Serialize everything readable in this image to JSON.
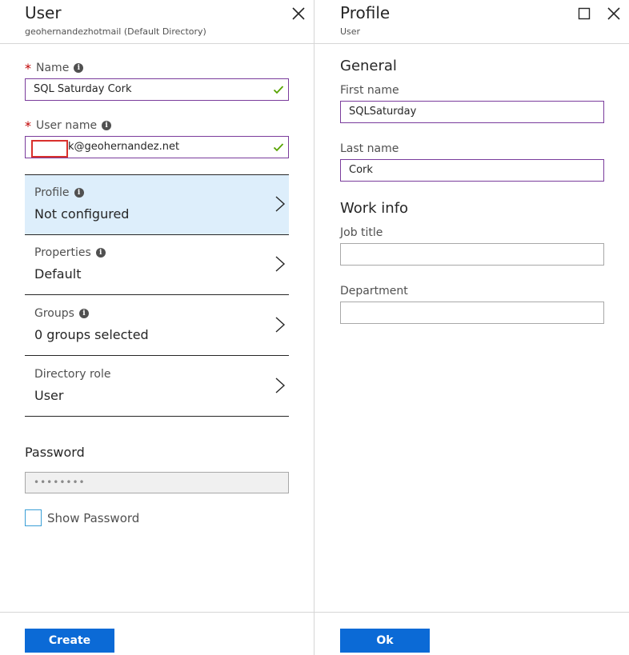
{
  "user_blade": {
    "title": "User",
    "subtitle": "geohernandezhotmail (Default Directory)",
    "name_label": "Name",
    "name_value": "SQL Saturday Cork",
    "username_label": "User name",
    "username_value": "k@geohernandez.net",
    "nav_items": [
      {
        "label": "Profile",
        "value": "Not configured",
        "has_info": true
      },
      {
        "label": "Properties",
        "value": "Default",
        "has_info": true
      },
      {
        "label": "Groups",
        "value": "0 groups selected",
        "has_info": true
      },
      {
        "label": "Directory role",
        "value": "User",
        "has_info": false
      }
    ],
    "password_heading": "Password",
    "password_value": "••••••••",
    "show_password_label": "Show Password",
    "create_label": "Create"
  },
  "profile_blade": {
    "title": "Profile",
    "subtitle": "User",
    "general_heading": "General",
    "first_name_label": "First name",
    "first_name_value": "SQLSaturday",
    "last_name_label": "Last name",
    "last_name_value": "Cork",
    "work_info_heading": "Work info",
    "job_title_label": "Job title",
    "job_title_value": "",
    "department_label": "Department",
    "department_value": "",
    "ok_label": "Ok"
  },
  "icons": {
    "close": "close-icon",
    "maximize": "maximize-icon",
    "info": "info-icon",
    "check": "check-icon",
    "chevron": "chevron-right-icon"
  },
  "colors": {
    "accent": "#0b6ad6",
    "selected": "#ddeefb",
    "valid_border": "#7a3c9c",
    "check": "#57a300",
    "required": "#c00000"
  }
}
